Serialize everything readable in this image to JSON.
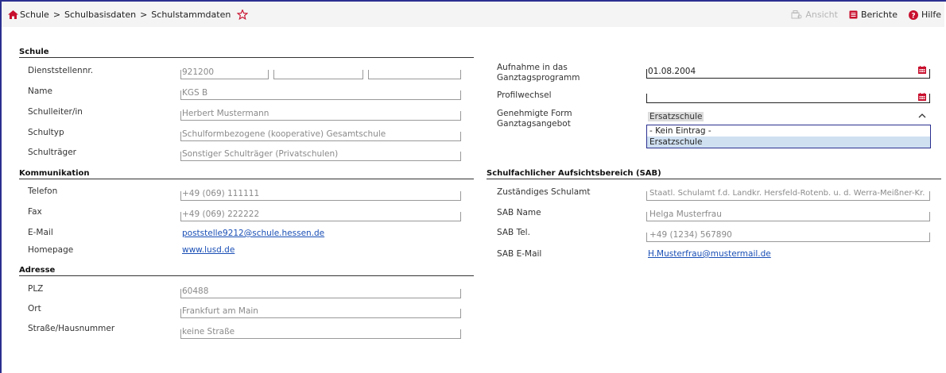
{
  "breadcrumb": {
    "items": [
      "Schule",
      "Schulbasisdaten",
      "Schulstammdaten"
    ],
    "separator": ">"
  },
  "toolbar": {
    "ansicht": "Ansicht",
    "berichte": "Berichte",
    "hilfe": "Hilfe"
  },
  "colors": {
    "accent_red": "#c8102e",
    "link": "#1a4fb5",
    "frame": "#2a2f8f"
  },
  "schule": {
    "title": "Schule",
    "dienststellennr_label": "Dienststellennr.",
    "dienststellennr": "921200",
    "name_label": "Name",
    "name": "KGS B",
    "schulleiter_label": "Schulleiter/in",
    "schulleiter": "Herbert Mustermann",
    "schultyp_label": "Schultyp",
    "schultyp": "Schulformbezogene (kooperative) Gesamtschule",
    "schultraeger_label": "Schulträger",
    "schultraeger": "Sonstiger Schulträger (Privatschulen)"
  },
  "ganztag": {
    "aufnahme_label_1": "Aufnahme in das",
    "aufnahme_label_2": "Ganztagsprogramm",
    "aufnahme": "01.08.2004",
    "profilwechsel_label": "Profilwechsel",
    "profilwechsel": "",
    "form_label_1": "Genehmigte Form",
    "form_label_2": "Ganztagsangebot",
    "form_selected": "Ersatzschule",
    "form_options": [
      "- Kein Eintrag -",
      "Ersatzschule"
    ]
  },
  "kommunikation": {
    "title": "Kommunikation",
    "telefon_label": "Telefon",
    "telefon": "+49 (069) 111111",
    "fax_label": "Fax",
    "fax": "+49 (069) 222222",
    "email_label": "E-Mail",
    "email": "poststelle9212@schule.hessen.de",
    "homepage_label": "Homepage",
    "homepage": "www.lusd.de"
  },
  "sab": {
    "title": "Schulfachlicher Aufsichtsbereich (SAB)",
    "schulamt_label": "Zuständiges Schulamt",
    "schulamt": "Staatl. Schulamt f.d. Landkr. Hersfeld-Rotenb. u. d. Werra-Meißner-Kr.",
    "name_label": "SAB Name",
    "name": "Helga Musterfrau",
    "tel_label": "SAB Tel.",
    "tel": "+49 (1234) 567890",
    "email_label": "SAB E-Mail",
    "email": "H.Musterfrau@mustermail.de"
  },
  "adresse": {
    "title": "Adresse",
    "plz_label": "PLZ",
    "plz": "60488",
    "ort_label": "Ort",
    "ort": "Frankfurt am Main",
    "strasse_label": "Straße/Hausnummer",
    "strasse": "keine Straße"
  }
}
